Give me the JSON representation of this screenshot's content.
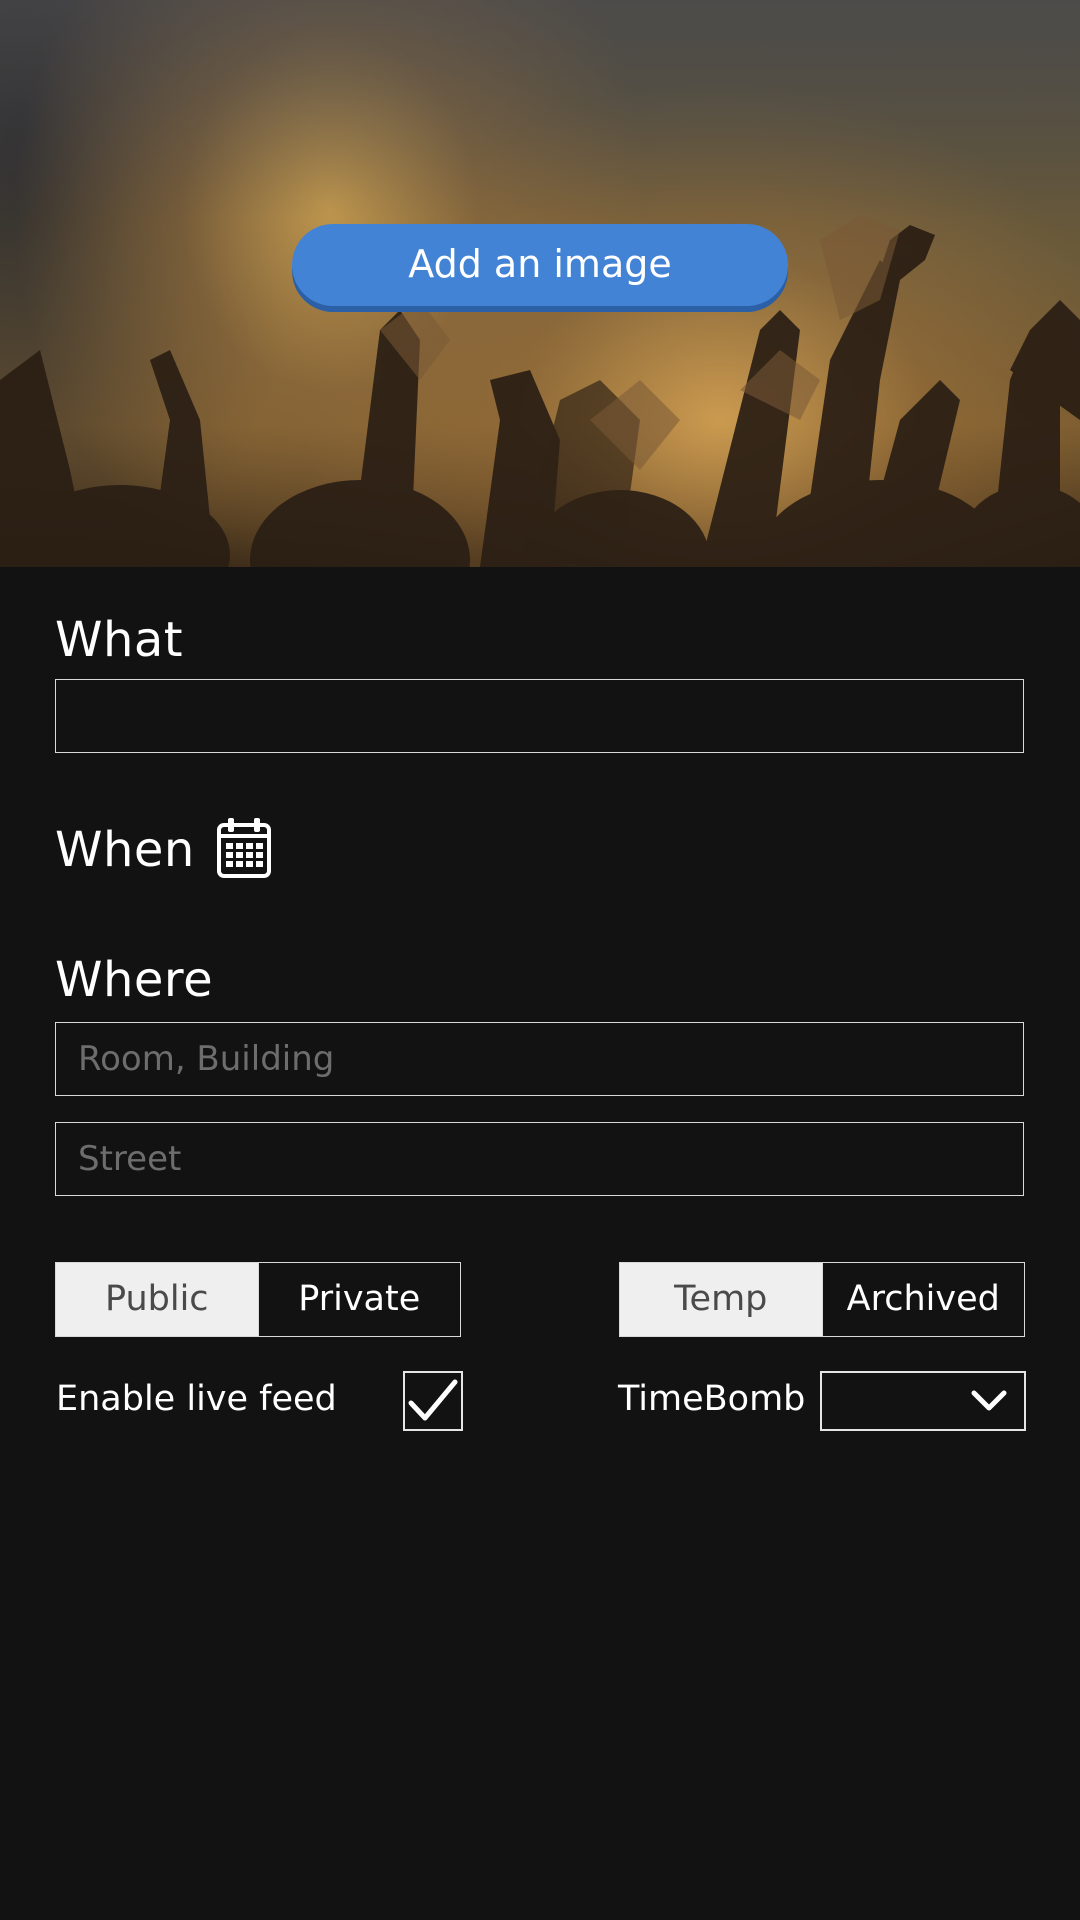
{
  "hero": {
    "add_image_label": "Add an image"
  },
  "form": {
    "what": {
      "label": "What",
      "value": "",
      "placeholder": ""
    },
    "when": {
      "label": "When",
      "icon": "calendar-icon"
    },
    "where": {
      "label": "Where",
      "room_placeholder": "Room, Building",
      "street_placeholder": "Street"
    },
    "visibility": {
      "options": [
        "Public",
        "Private"
      ],
      "selected": "Public"
    },
    "lifetime": {
      "options": [
        "Temp",
        "Archived"
      ],
      "selected": "Temp"
    },
    "live_feed": {
      "label": "Enable live feed",
      "checked": true
    },
    "timebomb": {
      "label": "TimeBomb",
      "value": "",
      "icon": "chevron-down-icon"
    }
  },
  "colors": {
    "background": "#121212",
    "accent_button": "#4383d5",
    "segment_selected": "#efefef",
    "border": "#d9d9d9"
  }
}
